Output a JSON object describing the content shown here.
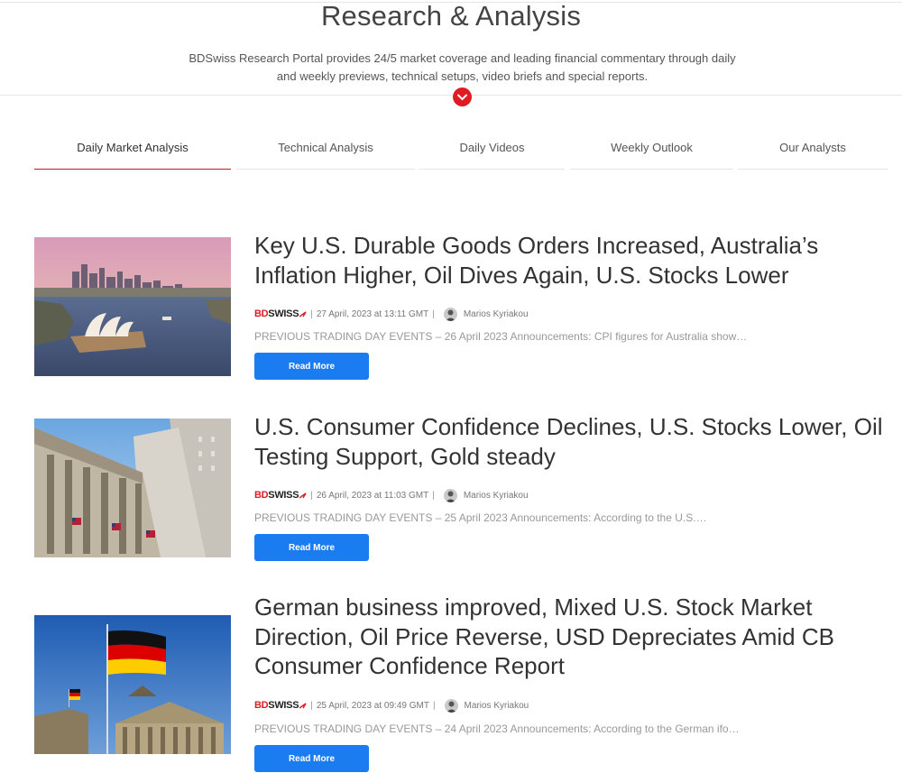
{
  "header": {
    "title": "Research & Analysis",
    "subtitle": "BDSwiss Research Portal provides 24/5 market coverage and leading financial commentary through daily and weekly previews, technical setups, video briefs and special reports."
  },
  "tabs": [
    {
      "label": "Daily Market Analysis",
      "active": true
    },
    {
      "label": "Technical Analysis",
      "active": false
    },
    {
      "label": "Daily Videos",
      "active": false
    },
    {
      "label": "Weekly Outlook",
      "active": false
    },
    {
      "label": "Our Analysts",
      "active": false
    }
  ],
  "brand": {
    "part1": "BD",
    "part2": "SWISS",
    "accent": "#e11b22"
  },
  "articles": [
    {
      "title": "Key U.S. Durable Goods Orders Increased, Australia’s Inflation Higher, Oil Dives Again, U.S. Stocks Lower",
      "date": "27 April, 2023 at 13:11 GMT",
      "author": "Marios Kyriakou",
      "excerpt": "PREVIOUS TRADING DAY EVENTS – 26 April 2023 Announcements:  CPI figures for Australia show…",
      "button": "Read More",
      "image": "sydney-opera-house-image"
    },
    {
      "title": "U.S. Consumer Confidence Declines, U.S. Stocks Lower, Oil Testing Support, Gold steady",
      "date": "26 April, 2023 at 11:03 GMT",
      "author": "Marios Kyriakou",
      "excerpt": "PREVIOUS TRADING DAY EVENTS – 25 April 2023 Announcements:  According to the U.S.…",
      "button": "Read More",
      "image": "stock-exchange-building-image"
    },
    {
      "title": "German business improved, Mixed U.S. Stock Market Direction, Oil Price Reverse, USD Depreciates Amid CB Consumer Confidence Report",
      "date": "25 April, 2023 at 09:49 GMT",
      "author": "Marios Kyriakou",
      "excerpt": "PREVIOUS TRADING DAY EVENTS – 24 April 2023 Announcements:  According to the German ifo…",
      "button": "Read More",
      "image": "german-flag-reichstag-image"
    }
  ],
  "colors": {
    "accent_red": "#e11b22",
    "button_blue": "#1a7cf0",
    "tab_active_underline": "#c8102e"
  }
}
